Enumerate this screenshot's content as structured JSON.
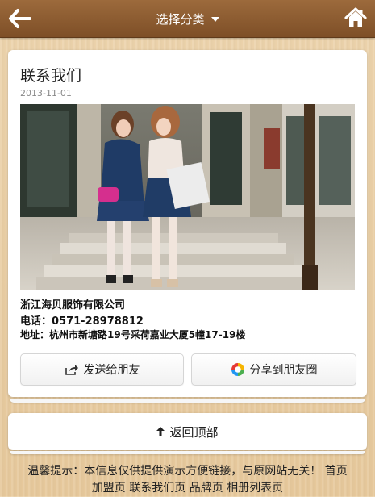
{
  "header": {
    "title": "选择分类",
    "back_icon": "arrow-left-icon",
    "home_icon": "home-icon",
    "dropdown_icon": "caret-down-icon"
  },
  "article": {
    "title": "联系我们",
    "date": "2013-11-01",
    "company": "浙江海贝服饰有限公司",
    "phone": "电话：0571-28978812",
    "address": "地址：杭州市新塘路19号采荷嘉业大厦5幢17-19楼"
  },
  "actions": {
    "send_label": "发送给朋友",
    "send_icon": "share-icon",
    "moments_label": "分享到朋友圈",
    "moments_icon": "moments-icon"
  },
  "back_to_top": {
    "label": "返回顶部",
    "icon": "arrow-up-icon"
  },
  "footer": {
    "notice": "温馨提示：本信息仅供提供演示方便链接，与原网站无关！",
    "links": [
      "首页",
      "加盟页",
      "联系我们页",
      "品牌页",
      "相册列表页"
    ]
  },
  "colors": {
    "topbar": "#8b5a2f",
    "background": "#e9cfa6"
  }
}
